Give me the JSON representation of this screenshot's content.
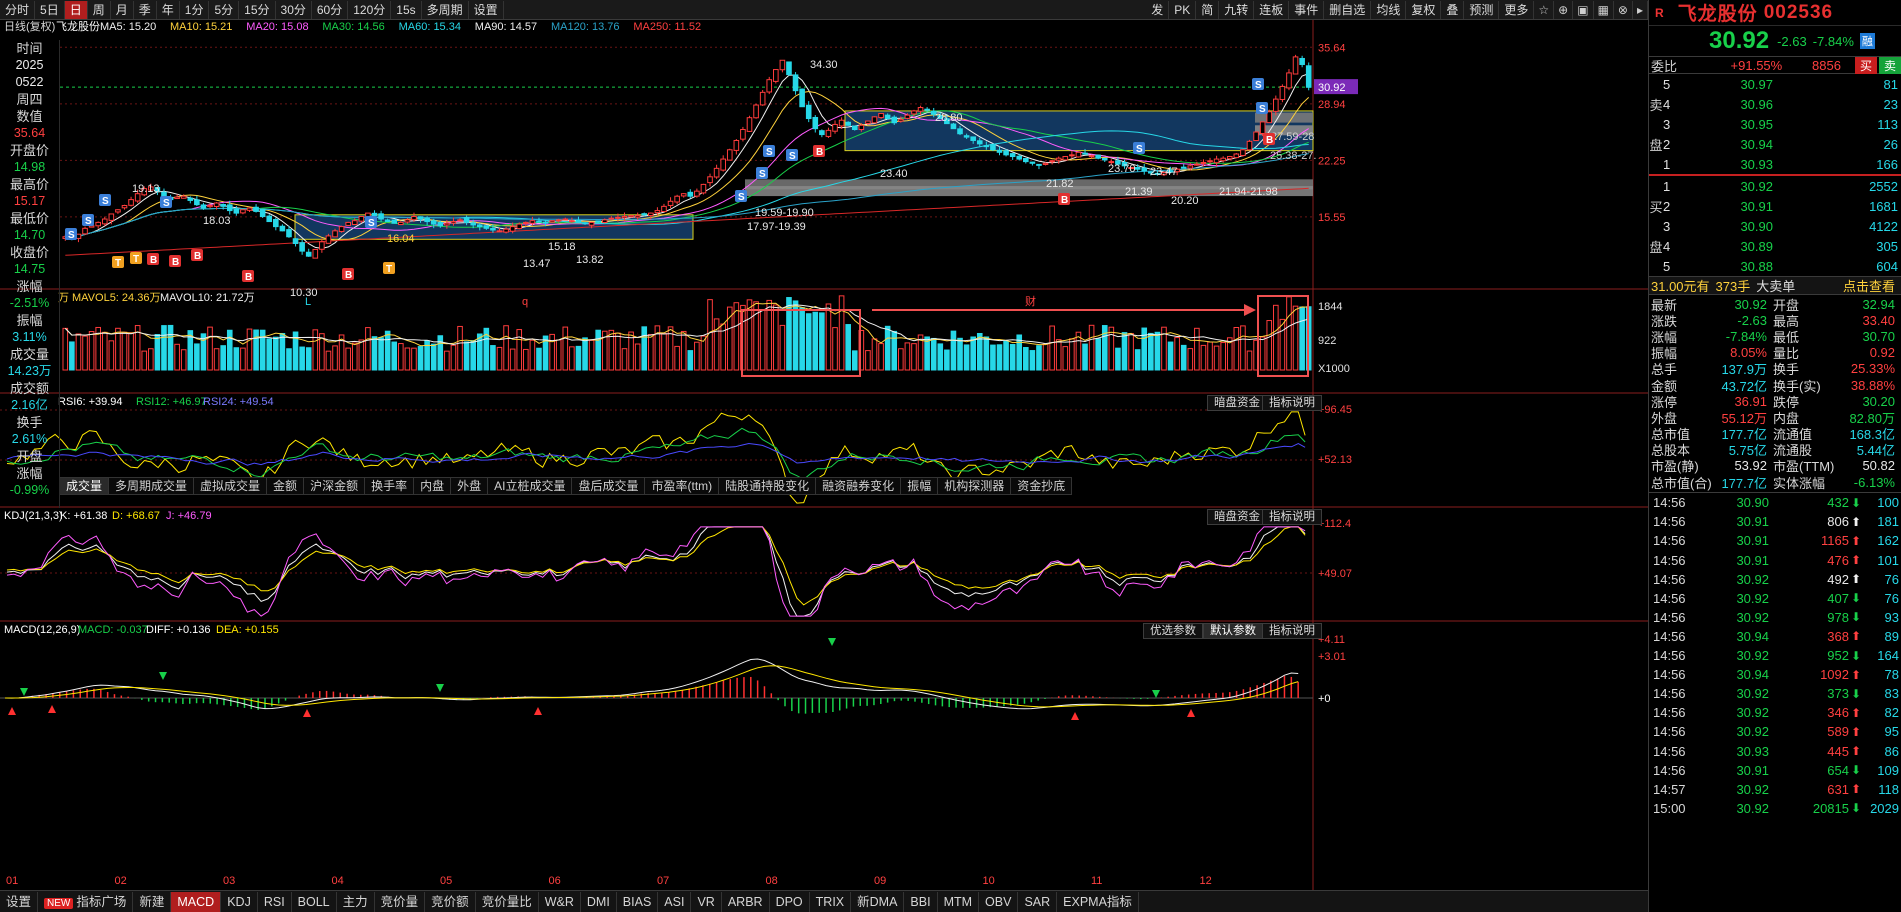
{
  "toolbar": {
    "left": [
      {
        "label": "分时",
        "active": false,
        "icon": "back-icon"
      },
      {
        "label": "5日",
        "active": false
      },
      {
        "label": "日",
        "active": true
      },
      {
        "label": "周",
        "active": false
      },
      {
        "label": "月",
        "active": false
      },
      {
        "label": "季",
        "active": false
      },
      {
        "label": "年",
        "active": false
      },
      {
        "label": "1分",
        "active": false
      },
      {
        "label": "5分",
        "active": false
      },
      {
        "label": "15分",
        "active": false
      },
      {
        "label": "30分",
        "active": false
      },
      {
        "label": "60分",
        "active": false
      },
      {
        "label": "120分",
        "active": false
      },
      {
        "label": "15s",
        "active": false
      },
      {
        "label": "多周期",
        "active": false
      },
      {
        "label": "设置",
        "active": false
      }
    ],
    "right": [
      "发",
      "PK",
      "简",
      "九转",
      "连板",
      "事件",
      "删自选",
      "均线",
      "复权",
      "叠",
      "预测",
      "更多"
    ]
  },
  "ma_legend": {
    "prefix": "日线(复权)",
    "stock": "飞龙股份",
    "items": [
      {
        "label": "MA5: 15.20",
        "color": "#f0f0f0"
      },
      {
        "label": "MA10: 15.21",
        "color": "#ffd23c"
      },
      {
        "label": "MA20: 15.08",
        "color": "#ff5cff"
      },
      {
        "label": "MA30: 14.56",
        "color": "#18d04a"
      },
      {
        "label": "MA60: 15.34",
        "color": "#27d8e8"
      },
      {
        "label": "MA90: 14.57",
        "color": "#f0f0f0"
      },
      {
        "label": "MA120: 13.76",
        "color": "#2aa2c8"
      },
      {
        "label": "MA250: 11.52",
        "color": "#ff4040"
      }
    ]
  },
  "left_info": {
    "time_label": "时间",
    "year": "2025",
    "date": "0522",
    "weekday": "周四",
    "value_label": "数值",
    "value": "35.64",
    "open_label": "开盘价",
    "open": "14.98",
    "high_label": "最高价",
    "high": "15.17",
    "low_label": "最低价",
    "low": "14.70",
    "close_label": "收盘价",
    "close": "14.75",
    "chg_label": "涨幅",
    "chg": "-2.51%",
    "amp_label": "振幅",
    "amp": "3.11%",
    "vol_label": "成交量",
    "vol": "14.23万",
    "amt_label": "成交额",
    "amt": "2.16亿",
    "turn_label": "换手",
    "turn": "2.61%",
    "openchg_label1": "开盘",
    "openchg_label2": "涨幅",
    "openchg": "-0.99%"
  },
  "price_axis": {
    "labels": [
      "35.64",
      "28.94",
      "22.25",
      "15.55"
    ],
    "current": "30.92"
  },
  "chart_data": {
    "type": "candlestick",
    "months": [
      "01",
      "02",
      "03",
      "04",
      "05",
      "06",
      "07",
      "08",
      "09",
      "10",
      "11",
      "12"
    ],
    "annotations": [
      "34.30",
      "28.80",
      "19.13",
      "18.03",
      "16.04",
      "15.18",
      "13.82",
      "13.47",
      "10.30",
      "23.70",
      "23.40",
      "23.47",
      "21.82",
      "21.39",
      "20.20",
      "21.94-21.98",
      "19.59-19.90",
      "17.97-19.39",
      "27.59-28",
      "25.38-27.",
      "L",
      "q",
      "财"
    ],
    "price_range": [
      9.5,
      36.5
    ],
    "closes": [
      13.2,
      13.0,
      13.5,
      14.2,
      14.5,
      14.9,
      15.3,
      15.9,
      16.4,
      16.9,
      17.6,
      18.3,
      18.9,
      19.1,
      18.6,
      18.0,
      17.6,
      17.9,
      18.0,
      17.5,
      17.0,
      16.6,
      16.9,
      17.2,
      16.8,
      16.3,
      16.0,
      16.4,
      16.6,
      16.2,
      15.6,
      15.0,
      14.4,
      13.9,
      13.2,
      12.4,
      11.5,
      10.9,
      11.7,
      12.6,
      13.3,
      13.9,
      14.4,
      14.9,
      15.1,
      15.6,
      16.0,
      15.7,
      15.3,
      15.0,
      14.8,
      14.9,
      15.2,
      15.6,
      15.3,
      15.0,
      14.7,
      14.5,
      14.8,
      15.0,
      15.2,
      14.9,
      14.6,
      14.4,
      14.2,
      14.0,
      13.9,
      14.1,
      14.4,
      14.7,
      14.9,
      15.1,
      15.0,
      14.9,
      15.1,
      15.2,
      15.3,
      15.1,
      14.9,
      14.8,
      14.9,
      15.0,
      15.2,
      15.4,
      15.5,
      15.6,
      15.7,
      15.7,
      15.8,
      16.0,
      16.3,
      16.8,
      17.4,
      18.0,
      18.3,
      18.0,
      18.6,
      19.4,
      20.3,
      21.3,
      22.4,
      23.5,
      24.6,
      25.9,
      27.3,
      28.8,
      30.3,
      31.8,
      33.0,
      34.1,
      32.4,
      30.5,
      28.6,
      27.2,
      26.0,
      25.3,
      25.8,
      26.5,
      27.0,
      26.4,
      25.9,
      26.4,
      26.9,
      27.4,
      27.8,
      27.2,
      26.7,
      27.1,
      27.6,
      28.1,
      28.5,
      28.2,
      27.7,
      27.2,
      26.6,
      26.0,
      25.4,
      25.0,
      24.6,
      24.2,
      23.9,
      23.5,
      23.2,
      22.9,
      22.7,
      22.4,
      22.1,
      21.9,
      21.7,
      21.9,
      22.2,
      22.5,
      22.7,
      22.9,
      23.2,
      23.0,
      22.8,
      22.5,
      22.3,
      22.1,
      21.8,
      21.6,
      21.4,
      21.2,
      21.0,
      20.8,
      20.6,
      20.8,
      21.0,
      21.2,
      21.4,
      21.6,
      21.8,
      22.0,
      22.2,
      22.4,
      22.5,
      22.7,
      23.0,
      23.5,
      24.5,
      25.6,
      26.8,
      28.0,
      29.5,
      31.0,
      32.6,
      34.5,
      33.6,
      30.9
    ],
    "volume_axis": [
      "1844",
      "922",
      "X1000"
    ],
    "volume_legend": {
      "suffix": "万",
      "mavol5": "MAVOL5: 24.36万",
      "mavol10": "MAVOL10: 21.72万"
    },
    "rsi": {
      "label": "RSI(6,12,24)",
      "rsi6": "RSI6: +39.94",
      "rsi12": "RSI12: +46.97",
      "rsi24": "RSI24: +49.54",
      "axis": [
        "+96.45",
        "+52.13"
      ]
    },
    "kdj": {
      "label": "KDJ(21,3,3)",
      "k": "K: +61.38",
      "d": "D: +68.67",
      "j": "J: +46.79",
      "axis": [
        "+112.4",
        "+49.07"
      ]
    },
    "macd": {
      "label": "MACD(12,26,9)",
      "macd": "MACD: -0.037",
      "diff": "DIFF: +0.136",
      "dea": "DEA: +0.155",
      "axis": [
        "+4.11",
        "+3.01",
        "+0"
      ]
    }
  },
  "panel_buttons": {
    "rsi": [
      "暗盘资金",
      "指标说明"
    ],
    "kdj": [
      "暗盘资金",
      "指标说明"
    ],
    "macd": [
      "优选参数",
      "默认参数",
      "指标说明"
    ]
  },
  "indicator_tabs": [
    "成交量",
    "多周期成交量",
    "虚拟成交量",
    "金额",
    "沪深金额",
    "换手率",
    "内盘",
    "外盘",
    "AI立桩成交量",
    "盘后成交量",
    "市盈率(ttm)",
    "陆股通持股变化",
    "融资融券变化",
    "振幅",
    "机构探测器",
    "资金抄底"
  ],
  "bottombar": {
    "items": [
      "设置",
      "指标广场",
      "新建",
      "MACD",
      "KDJ",
      "RSI",
      "BOLL",
      "主力",
      "竞价量",
      "竞价额",
      "竞价量比",
      "W&R",
      "DMI",
      "BIAS",
      "ASI",
      "VR",
      "ARBR",
      "DPO",
      "TRIX",
      "新DMA",
      "BBI",
      "MTM",
      "OBV",
      "SAR",
      "EXPMA指标"
    ],
    "new_badge": "NEW"
  },
  "quote": {
    "marker": "R",
    "name": "飞龙股份",
    "code": "002536",
    "price": "30.92",
    "change": "-2.63",
    "change_pct": "-7.84%",
    "badge": "融",
    "weibi_label": "委比",
    "weibi": "+91.55%",
    "weicha": "8856",
    "buy_btn": "买",
    "sell_btn": "卖",
    "ask_label": [
      "卖",
      "盘"
    ],
    "bid_label": [
      "买",
      "盘"
    ],
    "asks": [
      {
        "lvl": "5",
        "price": "30.97",
        "vol": "81"
      },
      {
        "lvl": "4",
        "price": "30.96",
        "vol": "23"
      },
      {
        "lvl": "3",
        "price": "30.95",
        "vol": "113"
      },
      {
        "lvl": "2",
        "price": "30.94",
        "vol": "26"
      },
      {
        "lvl": "1",
        "price": "30.93",
        "vol": "166"
      }
    ],
    "bids": [
      {
        "lvl": "1",
        "price": "30.92",
        "vol": "2552"
      },
      {
        "lvl": "2",
        "price": "30.91",
        "vol": "1681"
      },
      {
        "lvl": "3",
        "price": "30.90",
        "vol": "4122"
      },
      {
        "lvl": "4",
        "price": "30.89",
        "vol": "305"
      },
      {
        "lvl": "5",
        "price": "30.88",
        "vol": "604"
      }
    ],
    "bigorder": {
      "a": "31.00元有",
      "b": "373手",
      "c": "大卖单",
      "d": "点击查看"
    },
    "stats": [
      {
        "k": "最新",
        "v": "30.92",
        "vc": "c-g",
        "k2": "开盘",
        "v2": "32.94",
        "v2c": "c-g"
      },
      {
        "k": "涨跌",
        "v": "-2.63",
        "vc": "c-g",
        "k2": "最高",
        "v2": "33.40",
        "v2c": "c-r"
      },
      {
        "k": "涨幅",
        "v": "-7.84%",
        "vc": "c-g",
        "k2": "最低",
        "v2": "30.70",
        "v2c": "c-g"
      },
      {
        "k": "振幅",
        "v": "8.05%",
        "vc": "c-r",
        "k2": "量比",
        "v2": "0.92",
        "v2c": "c-r"
      },
      {
        "k": "总手",
        "v": "137.9万",
        "vc": "c-c",
        "k2": "换手",
        "v2": "25.33%",
        "v2c": "c-r"
      },
      {
        "k": "金额",
        "v": "43.72亿",
        "vc": "c-c",
        "k2": "换手(实)",
        "v2": "38.88%",
        "v2c": "c-r"
      },
      {
        "k": "涨停",
        "v": "36.91",
        "vc": "c-r",
        "k2": "跌停",
        "v2": "30.20",
        "v2c": "c-g"
      },
      {
        "k": "外盘",
        "v": "55.12万",
        "vc": "c-r",
        "k2": "内盘",
        "v2": "82.80万",
        "v2c": "c-g"
      },
      {
        "k": "总市值",
        "v": "177.7亿",
        "vc": "c-c",
        "k2": "流通值",
        "v2": "168.3亿",
        "v2c": "c-c"
      },
      {
        "k": "总股本",
        "v": "5.75亿",
        "vc": "c-c",
        "k2": "流通股",
        "v2": "5.44亿",
        "v2c": "c-c"
      },
      {
        "k": "市盈(静)",
        "v": "53.92",
        "vc": "c-w",
        "k2": "市盈(TTM)",
        "v2": "50.82",
        "v2c": "c-w"
      },
      {
        "k": "总市值(合)",
        "v": "177.7亿",
        "vc": "c-c",
        "k2": "实体涨幅",
        "v2": "-6.13%",
        "v2c": "c-g"
      }
    ],
    "ticks": [
      {
        "t": "14:56",
        "p": "30.90",
        "v": "432",
        "vc": "c-g",
        "dir": "down",
        "n": "100"
      },
      {
        "t": "14:56",
        "p": "30.91",
        "v": "806",
        "vc": "c-w",
        "dir": "up-w",
        "n": "181"
      },
      {
        "t": "14:56",
        "p": "30.91",
        "v": "1165",
        "vc": "c-r",
        "dir": "up",
        "n": "162"
      },
      {
        "t": "14:56",
        "p": "30.91",
        "v": "476",
        "vc": "c-r",
        "dir": "up",
        "n": "101"
      },
      {
        "t": "14:56",
        "p": "30.92",
        "v": "492",
        "vc": "c-w",
        "dir": "up-w",
        "n": "76"
      },
      {
        "t": "14:56",
        "p": "30.92",
        "v": "407",
        "vc": "c-g",
        "dir": "down",
        "n": "76"
      },
      {
        "t": "14:56",
        "p": "30.92",
        "v": "978",
        "vc": "c-g",
        "dir": "down",
        "n": "93"
      },
      {
        "t": "14:56",
        "p": "30.94",
        "v": "368",
        "vc": "c-r",
        "dir": "up",
        "n": "89"
      },
      {
        "t": "14:56",
        "p": "30.92",
        "v": "952",
        "vc": "c-g",
        "dir": "down",
        "n": "164"
      },
      {
        "t": "14:56",
        "p": "30.94",
        "v": "1092",
        "vc": "c-r",
        "dir": "up",
        "n": "78"
      },
      {
        "t": "14:56",
        "p": "30.92",
        "v": "373",
        "vc": "c-g",
        "dir": "down",
        "n": "83"
      },
      {
        "t": "14:56",
        "p": "30.92",
        "v": "346",
        "vc": "c-r",
        "dir": "up",
        "n": "82"
      },
      {
        "t": "14:56",
        "p": "30.92",
        "v": "589",
        "vc": "c-r",
        "dir": "up",
        "n": "95"
      },
      {
        "t": "14:56",
        "p": "30.93",
        "v": "445",
        "vc": "c-r",
        "dir": "up",
        "n": "86"
      },
      {
        "t": "14:56",
        "p": "30.91",
        "v": "654",
        "vc": "c-g",
        "dir": "down",
        "n": "109"
      },
      {
        "t": "14:57",
        "p": "30.92",
        "v": "631",
        "vc": "c-r",
        "dir": "up",
        "n": "118"
      },
      {
        "t": "15:00",
        "p": "30.92",
        "v": "20815",
        "vc": "c-g",
        "dir": "down",
        "n": "2029"
      }
    ]
  }
}
